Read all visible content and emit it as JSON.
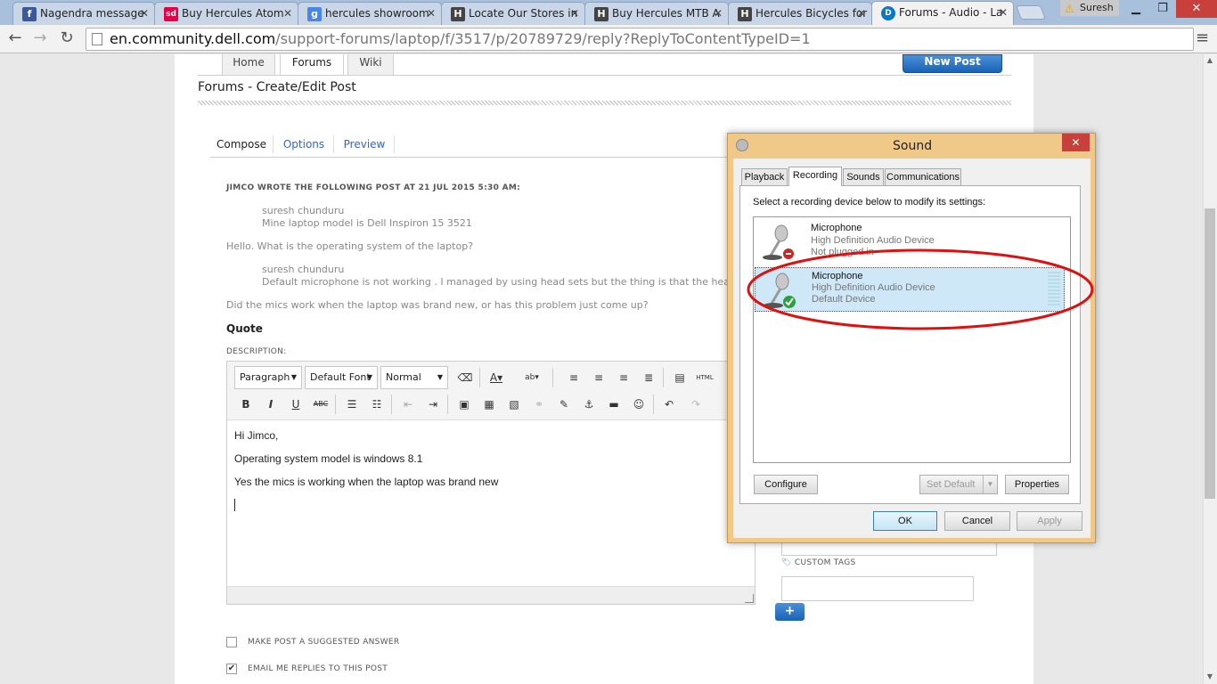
{
  "browser": {
    "tabs": [
      {
        "title": "Nagendra message",
        "icon": "facebook-icon",
        "color": "#3b5998",
        "glyph": "f"
      },
      {
        "title": "Buy Hercules Atom",
        "icon": "snapdeal-icon",
        "color": "#e40046",
        "glyph": "sd"
      },
      {
        "title": "hercules showroom",
        "icon": "google-icon",
        "color": "#4a86e8",
        "glyph": "g"
      },
      {
        "title": "Locate Our Stores in",
        "icon": "hercules-logo-icon",
        "color": "#444444",
        "glyph": "H"
      },
      {
        "title": "Buy Hercules MTB A",
        "icon": "hercules-logo-icon",
        "color": "#444444",
        "glyph": "H"
      },
      {
        "title": "Hercules Bicycles for",
        "icon": "hercules-logo-icon",
        "color": "#444444",
        "glyph": "H"
      },
      {
        "title": "Forums - Audio - La",
        "icon": "dell-logo-icon",
        "color": "#0a77c8",
        "glyph": "D"
      }
    ],
    "user": "Suresh",
    "url_host": "en.community.dell.com",
    "url_path": "/support-forums/laptop/f/3517/p/20789729/reply?ReplyToContentTypeID=1"
  },
  "site": {
    "nav": {
      "home": "Home",
      "forums": "Forums",
      "wiki": "Wiki"
    },
    "new_post": "New Post",
    "page_title": "Forums - Create/Edit Post",
    "compose_tabs": {
      "compose": "Compose",
      "options": "Options",
      "preview": "Preview"
    }
  },
  "post": {
    "wrote_header": "JIMCO WROTE THE FOLLOWING POST AT 21 JUL 2015 5:30 AM:",
    "q1_author": "suresh chunduru",
    "q1_text": "Mine laptop model is Dell Inspiron 15  3521",
    "reply1": "Hello. What is the operating system of the laptop?",
    "q2_author": "suresh chunduru",
    "q2_text": "Default microphone is not working . I managed by using head sets but the thing is that the hea",
    "reply2": "Did the mics work when the laptop was brand new, or has this problem just come up?",
    "quote_label": "Quote",
    "description_label": "DESCRIPTION:"
  },
  "editor": {
    "paragraph": "Paragraph",
    "font": "Default Font",
    "size": "Normal",
    "html_label": "HTML",
    "lines": [
      "Hi Jimco,",
      "Operating system model is windows 8.1",
      "Yes the mics is working when the laptop was brand new"
    ]
  },
  "options": {
    "suggested_answer": "MAKE POST A SUGGESTED ANSWER",
    "email_replies": "EMAIL ME REPLIES TO THIS POST",
    "email_checked": true,
    "suggested_checked": false,
    "custom_tags": "CUSTOM TAGS",
    "add_button": "+"
  },
  "sound_dialog": {
    "title": "Sound",
    "tabs": [
      "Playback",
      "Recording",
      "Sounds",
      "Communications"
    ],
    "active_tab": "Recording",
    "instruction": "Select a recording device below to modify its settings:",
    "devices": [
      {
        "name": "Microphone",
        "driver": "High Definition Audio Device",
        "status": "Not plugged in"
      },
      {
        "name": "Microphone",
        "driver": "High Definition Audio Device",
        "status": "Default Device"
      }
    ],
    "buttons": {
      "configure": "Configure",
      "set_default": "Set Default",
      "properties": "Properties",
      "ok": "OK",
      "cancel": "Cancel",
      "apply": "Apply"
    }
  },
  "colors": {
    "annotation": "#dd1111",
    "dialog_frame": "#f0c888",
    "link_blue": "#3366cc",
    "button_blue": "#1a62b4"
  }
}
